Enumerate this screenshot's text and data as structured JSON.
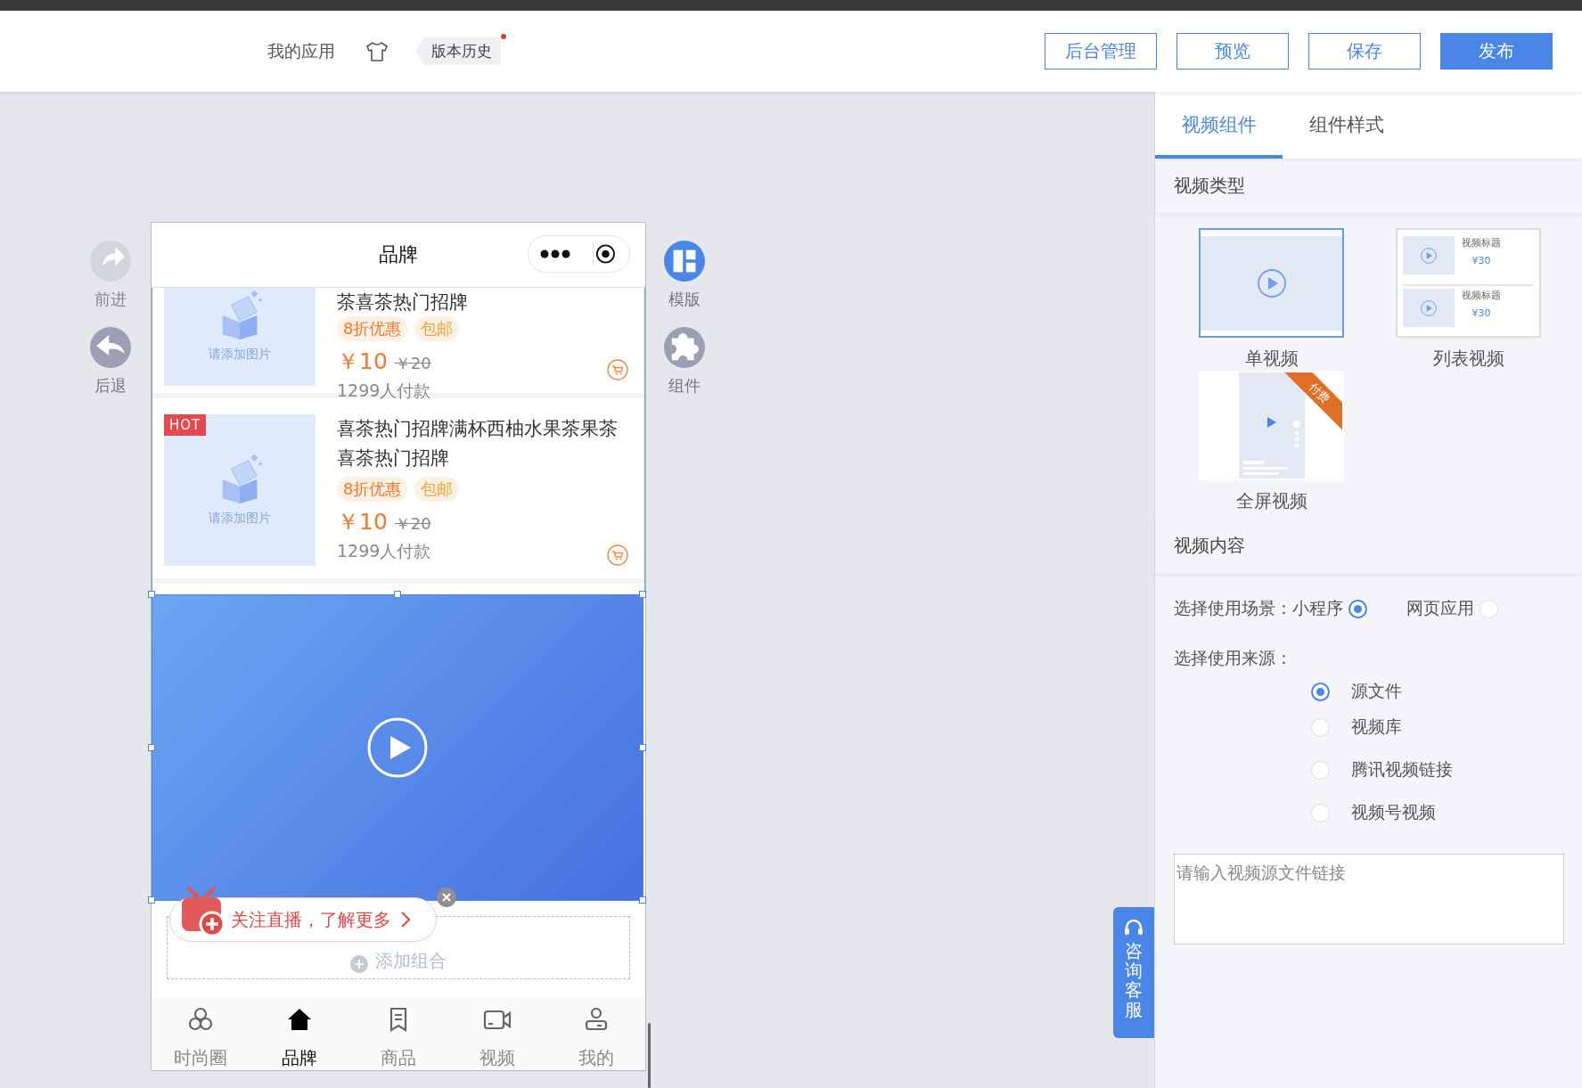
{
  "header": {
    "app_link": "我的应用",
    "version_history": "版本历史",
    "version_dot": true,
    "buttons": [
      {
        "label": "后台管理",
        "primary": false
      },
      {
        "label": "预览",
        "primary": false
      },
      {
        "label": "保存",
        "primary": false
      },
      {
        "label": "发布",
        "primary": true
      }
    ]
  },
  "side_left": [
    {
      "label": "前进",
      "kind": "forward",
      "disabled": true
    },
    {
      "label": "后退",
      "kind": "back",
      "disabled": false
    }
  ],
  "side_right": [
    {
      "label": "模版",
      "kind": "template",
      "active": true
    },
    {
      "label": "组件",
      "kind": "component",
      "active": false
    }
  ],
  "phone": {
    "title": "品牌",
    "products": [
      {
        "title": "茶喜茶热门招牌",
        "cut": true,
        "image_hint": "请添加图片",
        "tags": [
          "8折优惠",
          "包邮"
        ],
        "price": "￥10",
        "old_price": "￥20",
        "sales": "1299人付款"
      },
      {
        "title": "喜茶热门招牌满杯西柚水果茶果茶喜茶热门招牌",
        "cut": false,
        "hot": "HOT",
        "image_hint": "请添加图片",
        "tags": [
          "8折优惠",
          "包邮"
        ],
        "price": "￥10",
        "old_price": "￥20",
        "sales": "1299人付款"
      }
    ],
    "add_group": "添加组合",
    "live_banner": "关注直播，了解更多",
    "tabbar": [
      {
        "label": "时尚圈",
        "kind": "circles",
        "selected": false
      },
      {
        "label": "品牌",
        "kind": "home",
        "selected": true
      },
      {
        "label": "商品",
        "kind": "doc",
        "selected": false
      },
      {
        "label": "视频",
        "kind": "camera",
        "selected": false
      },
      {
        "label": "我的",
        "kind": "user",
        "selected": false
      }
    ]
  },
  "consult": "咨询客服",
  "panel": {
    "tabs": [
      {
        "label": "视频组件",
        "selected": true
      },
      {
        "label": "组件样式",
        "selected": false
      }
    ],
    "type_section": "视频类型",
    "types": [
      {
        "label": "单视频",
        "kind": "single",
        "selected": true
      },
      {
        "label": "列表视频",
        "kind": "list",
        "selected": false,
        "items": [
          {
            "title": "视频标题",
            "price": "¥30"
          },
          {
            "title": "视频标题",
            "price": "¥30"
          }
        ]
      },
      {
        "label": "全屏视频",
        "kind": "fullscreen",
        "selected": false,
        "badge": "付费"
      }
    ],
    "content_section": "视频内容",
    "scene_label": "选择使用场景：",
    "scenes": [
      {
        "label": "小程序",
        "selected": true
      },
      {
        "label": "网页应用",
        "selected": false
      }
    ],
    "source_label": "选择使用来源：",
    "sources": [
      {
        "label": "源文件",
        "selected": true
      },
      {
        "label": "视频库",
        "selected": false
      },
      {
        "label": "腾讯视频链接",
        "selected": false
      },
      {
        "label": "视频号视频",
        "selected": false
      }
    ],
    "link_placeholder": "请输入视频源文件链接"
  }
}
